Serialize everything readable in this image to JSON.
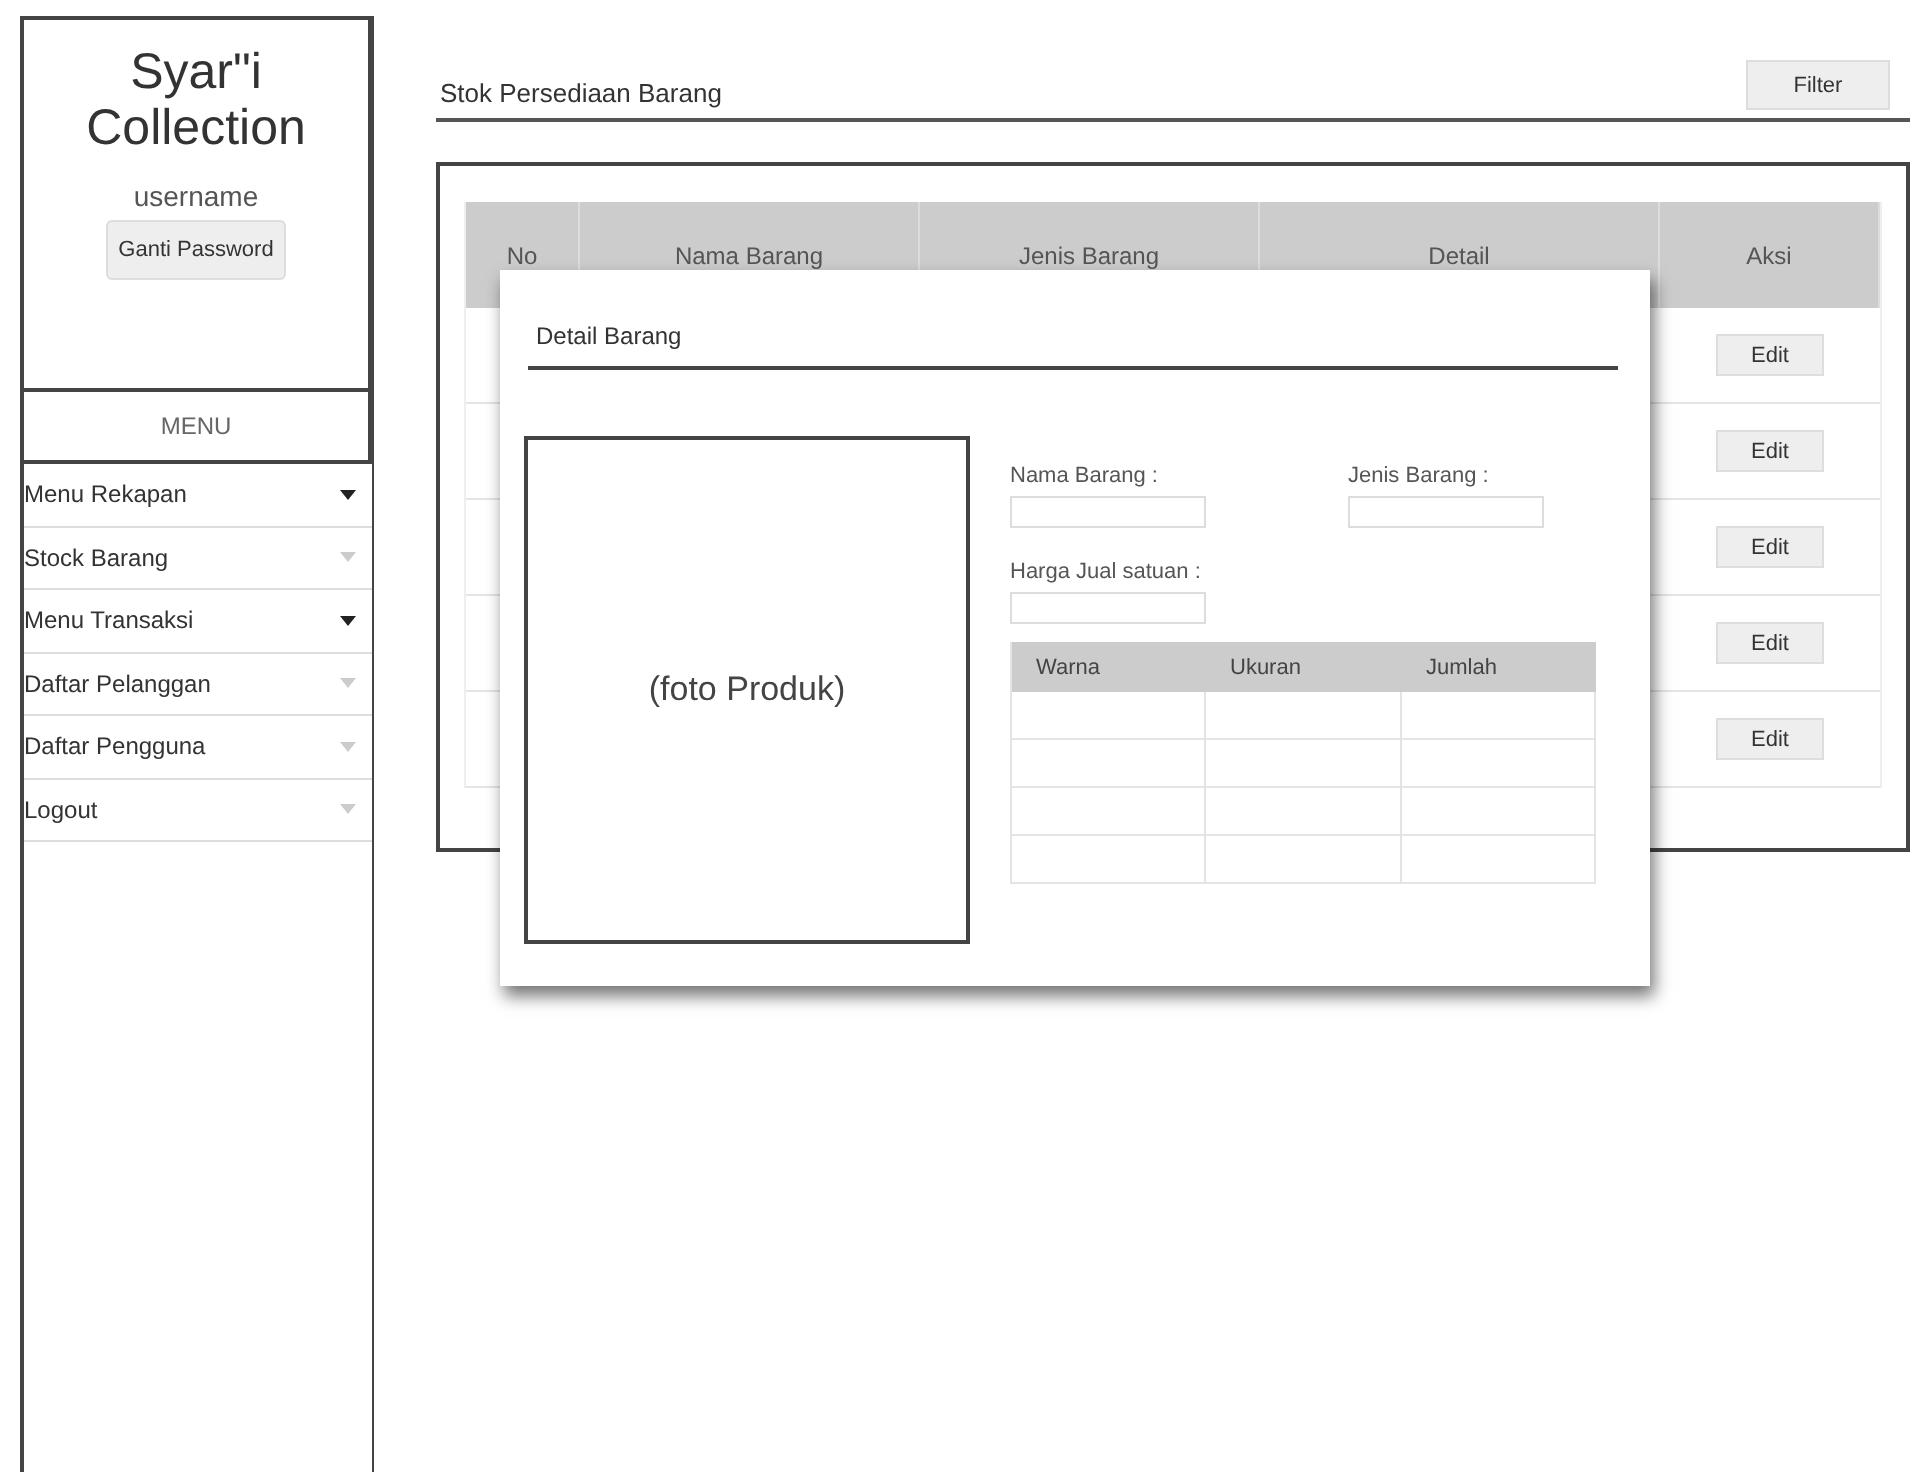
{
  "sidebar": {
    "brand_line1": "Syar\"i",
    "brand_line2": "Collection",
    "username": "username",
    "password_button": "Ganti Password",
    "menu_heading": "MENU",
    "items": [
      {
        "label": "Menu Rekapan",
        "kind": "dropdown"
      },
      {
        "label": "Stock Barang",
        "kind": "link"
      },
      {
        "label": "Menu Transaksi",
        "kind": "dropdown"
      },
      {
        "label": "Daftar Pelanggan",
        "kind": "link"
      },
      {
        "label": "Daftar Pengguna",
        "kind": "link"
      },
      {
        "label": "Logout",
        "kind": "link"
      }
    ]
  },
  "page": {
    "title": "Stok Persediaan Barang",
    "filter_button": "Filter"
  },
  "table": {
    "columns": [
      "No",
      "Nama Barang",
      "Jenis Barang",
      "Detail",
      "Aksi"
    ],
    "rows": [
      {
        "action": "Edit"
      },
      {
        "action": "Edit"
      },
      {
        "action": "Edit"
      },
      {
        "action": "Edit"
      },
      {
        "action": "Edit"
      }
    ]
  },
  "modal": {
    "title": "Detail Barang",
    "photo_label": "(foto Produk)",
    "fields": [
      {
        "label": "Nama Barang :"
      },
      {
        "label": "Jenis Barang :"
      },
      {
        "label": "Harga Jual satuan :"
      }
    ],
    "variant_table": {
      "columns": [
        "Warna",
        "Ukuran",
        "Jumlah"
      ],
      "rows": [
        {},
        {},
        {},
        {}
      ]
    }
  }
}
